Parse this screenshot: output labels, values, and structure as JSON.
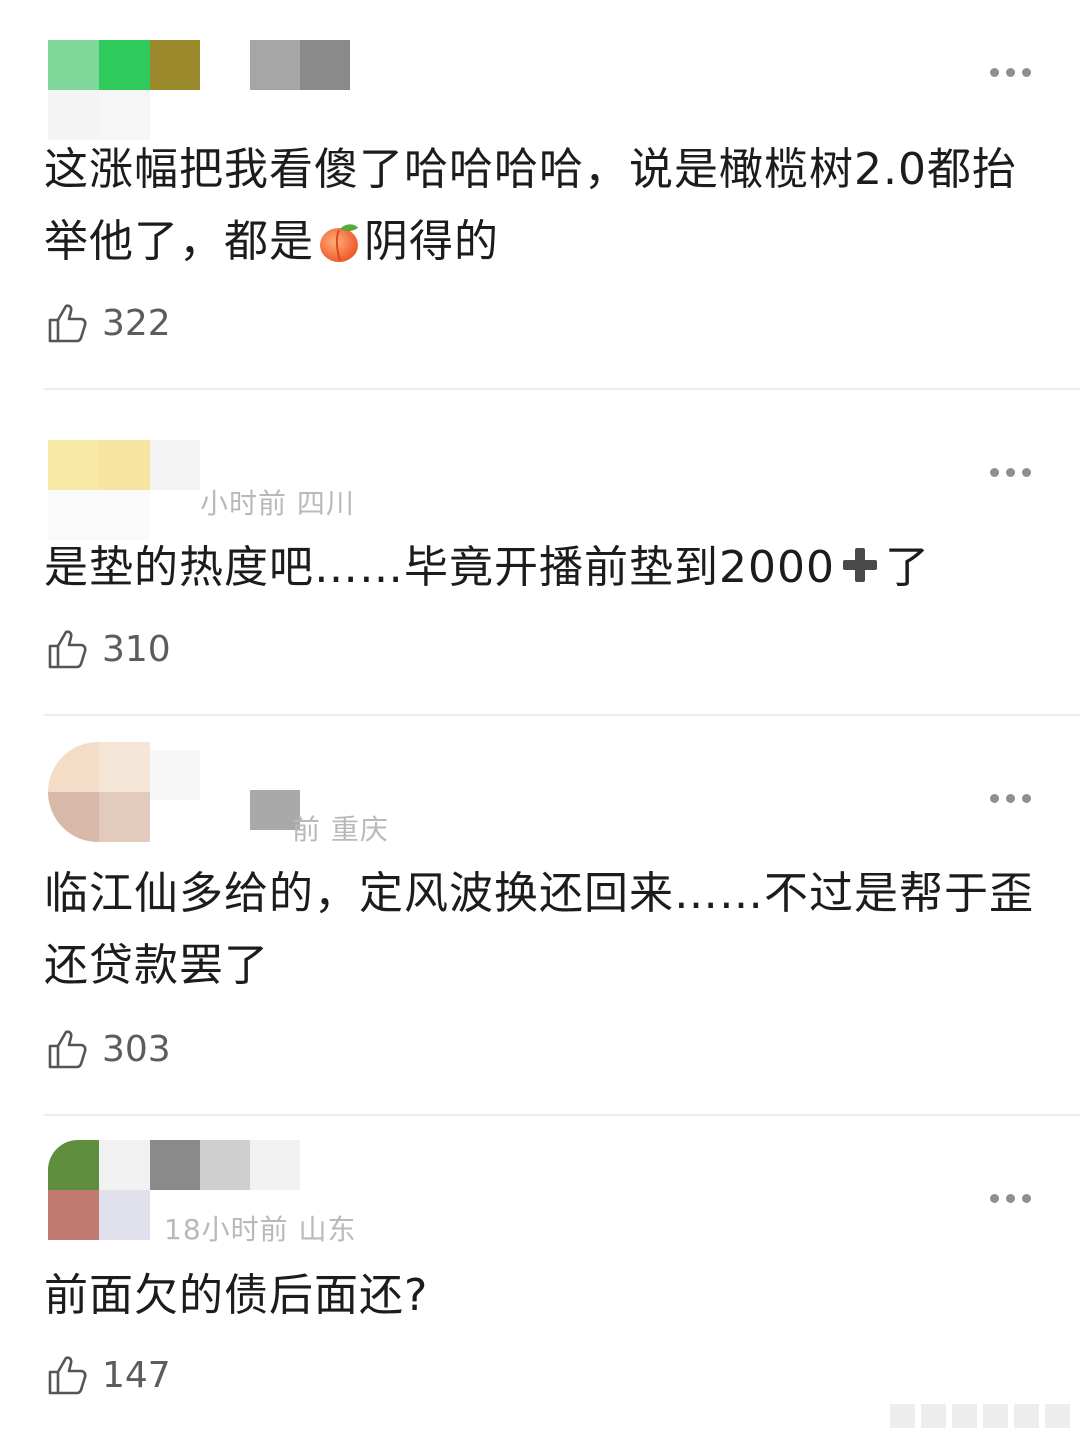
{
  "comments": [
    {
      "meta": "",
      "text_line1": "这涨幅把我看傻了哈哈哈哈，说是橄榄树2.0都抬",
      "text_line2_a": "举他了，都是",
      "text_line2_emoji": "peach-emoji",
      "text_line2_b": "阴得的",
      "likes": "322"
    },
    {
      "meta": "小时前 四川",
      "text_a": "是垫的热度吧……毕竟开播前垫到2000",
      "text_emoji": "plus-emoji",
      "text_b": "了",
      "likes": "310"
    },
    {
      "meta": "前 重庆",
      "text_line1": "临江仙多给的，定风波换还回来……不过是帮于歪",
      "text_line2": "还贷款罢了",
      "likes": "303"
    },
    {
      "meta": "18小时前 山东",
      "text_line1": "前面欠的债后面还?",
      "likes": "147"
    }
  ],
  "icons": {
    "like": "thumbs-up-icon",
    "more": "more-dots-icon"
  },
  "colors": {
    "text": "#1c1c1c",
    "meta": "#b9b9b9",
    "count": "#5c5c5c",
    "divider": "#eeeeee"
  }
}
